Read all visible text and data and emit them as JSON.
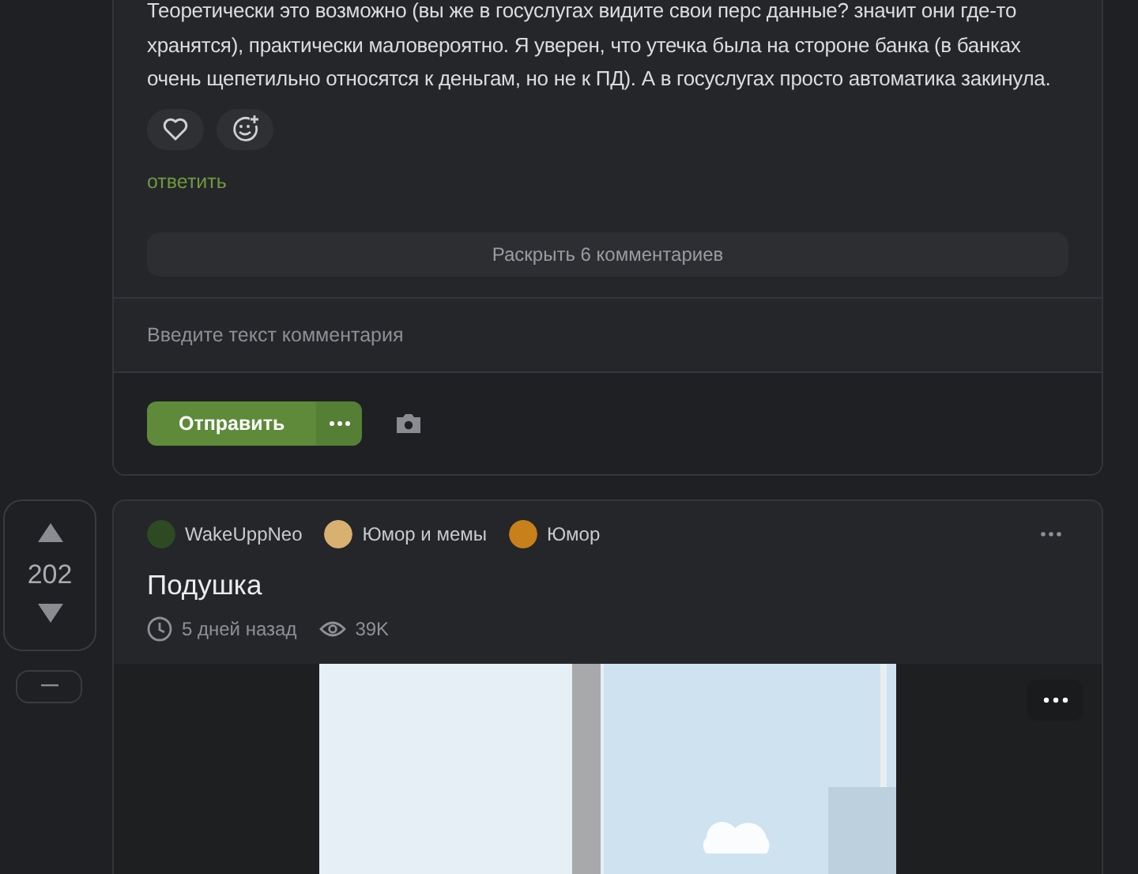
{
  "comment_card": {
    "text": "Теоретически это возможно (вы же в госуслугах видите свои перс данные? значит они где-то хранятся), практически маловероятно. Я уверен, что утечка была на стороне банка (в банках очень щепетильно относятся к деньгам, но не к ПД). А в госуслугах просто автоматика закинула.",
    "reply_link": "ответить",
    "expand_button": "Раскрыть 6 комментариев",
    "comment_input": {
      "placeholder": "Введите текст комментария"
    },
    "send_button": "Отправить"
  },
  "post": {
    "rating": "202",
    "communities": [
      {
        "name": "WakeUppNeo",
        "color": "#2e4a22"
      },
      {
        "name": "Юмор и мемы",
        "color": "#d8b070"
      },
      {
        "name": "Юмор",
        "color": "#c8801a"
      }
    ],
    "title": "Подушка",
    "time": "5 дней назад",
    "views": "39K"
  }
}
